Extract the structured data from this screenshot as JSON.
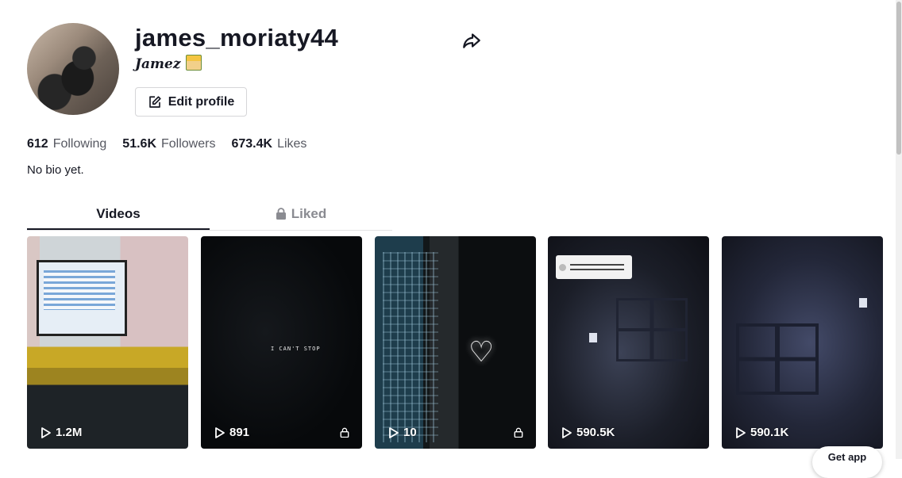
{
  "profile": {
    "username": "james_moriaty44",
    "nickname": "Jamez",
    "edit_label": "Edit profile",
    "bio": "No bio yet."
  },
  "stats": [
    {
      "value": "612",
      "label": "Following"
    },
    {
      "value": "51.6K",
      "label": "Followers"
    },
    {
      "value": "673.4K",
      "label": "Likes"
    }
  ],
  "tabs": {
    "videos": "Videos",
    "liked": "Liked"
  },
  "videos": [
    {
      "views": "1.2M",
      "locked": false,
      "caption": ""
    },
    {
      "views": "891",
      "locked": true,
      "caption": "I CAN'T STOP"
    },
    {
      "views": "10",
      "locked": true,
      "caption": ""
    },
    {
      "views": "590.5K",
      "locked": false,
      "caption": ""
    },
    {
      "views": "590.1K",
      "locked": false,
      "caption": ""
    }
  ],
  "get_app": "Get app",
  "icons": {
    "share": "share-arrow-icon",
    "edit": "edit-pencil-icon",
    "lock": "lock-icon",
    "play": "play-icon"
  }
}
